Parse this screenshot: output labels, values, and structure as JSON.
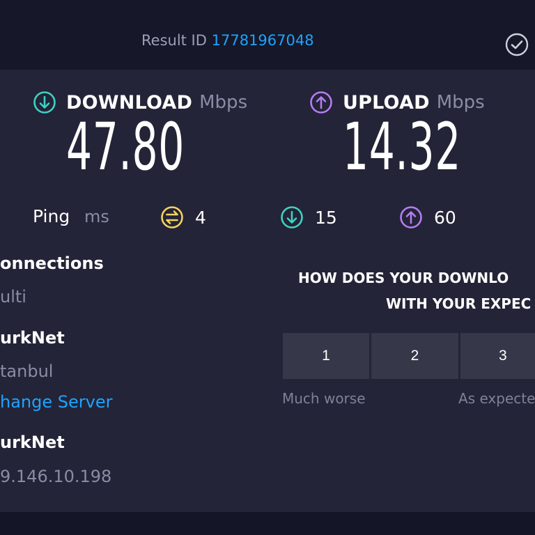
{
  "header": {
    "result_label": "Result ID",
    "result_id": "17781967048"
  },
  "download": {
    "label": "DOWNLOAD",
    "unit": "Mbps",
    "value": "47.80"
  },
  "upload": {
    "label": "UPLOAD",
    "unit": "Mbps",
    "value": "14.32"
  },
  "ping": {
    "label": "Ping",
    "unit": "ms",
    "idle": "4",
    "download": "15",
    "upload": "60"
  },
  "info": {
    "connections_label": "onnections",
    "connections_value": "ulti",
    "isp_name": "urkNet",
    "server_location": "tanbul",
    "change_server": "hange Server",
    "host_name": "urkNet",
    "ip_address": "9.146.10.198"
  },
  "survey": {
    "question_line1": "HOW DOES YOUR DOWNLO",
    "question_line2": "WITH YOUR EXPEC",
    "options": [
      "1",
      "2",
      "3"
    ],
    "caption_low": "Much worse",
    "caption_mid": "As expecte"
  },
  "colors": {
    "accent_link": "#1fa3ff",
    "download_icon": "#3fd1c4",
    "upload_icon": "#b67cf2",
    "ping_icon": "#f4d35e"
  }
}
